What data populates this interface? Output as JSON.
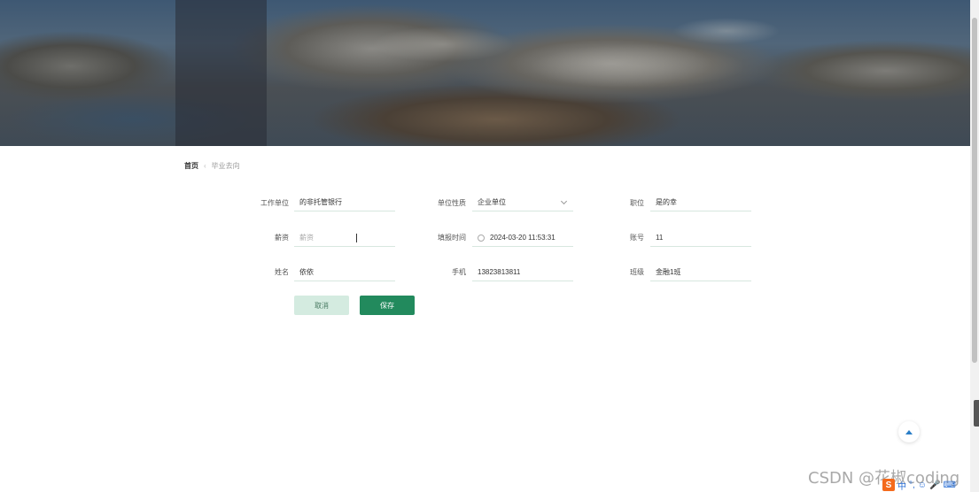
{
  "breadcrumb": {
    "home": "首页",
    "separator": "‹",
    "current": "毕业去向"
  },
  "form": {
    "work_unit": {
      "label": "工作单位",
      "value": "的非托管银行"
    },
    "unit_type": {
      "label": "单位性质",
      "value": "企业单位"
    },
    "position": {
      "label": "职位",
      "value": "是的幸"
    },
    "salary": {
      "label": "薪资",
      "placeholder": "薪资"
    },
    "fill_time": {
      "label": "填报时间",
      "value": "2024-03-20 11:53:31"
    },
    "account": {
      "label": "账号",
      "value": "11"
    },
    "name": {
      "label": "姓名",
      "value": "依依"
    },
    "phone": {
      "label": "手机",
      "value": "13823813811"
    },
    "class": {
      "label": "班级",
      "value": "金融1班"
    }
  },
  "buttons": {
    "cancel": "取消",
    "save": "保存"
  },
  "watermark": "CSDN @花椒coding",
  "ime": {
    "logo": "S",
    "items": [
      "中",
      "°,",
      "☺",
      "🎤",
      "⌨"
    ]
  },
  "colors": {
    "primary": "#228a5d",
    "cancel_bg": "#d4ebe0",
    "underline": "#d7e7df"
  }
}
